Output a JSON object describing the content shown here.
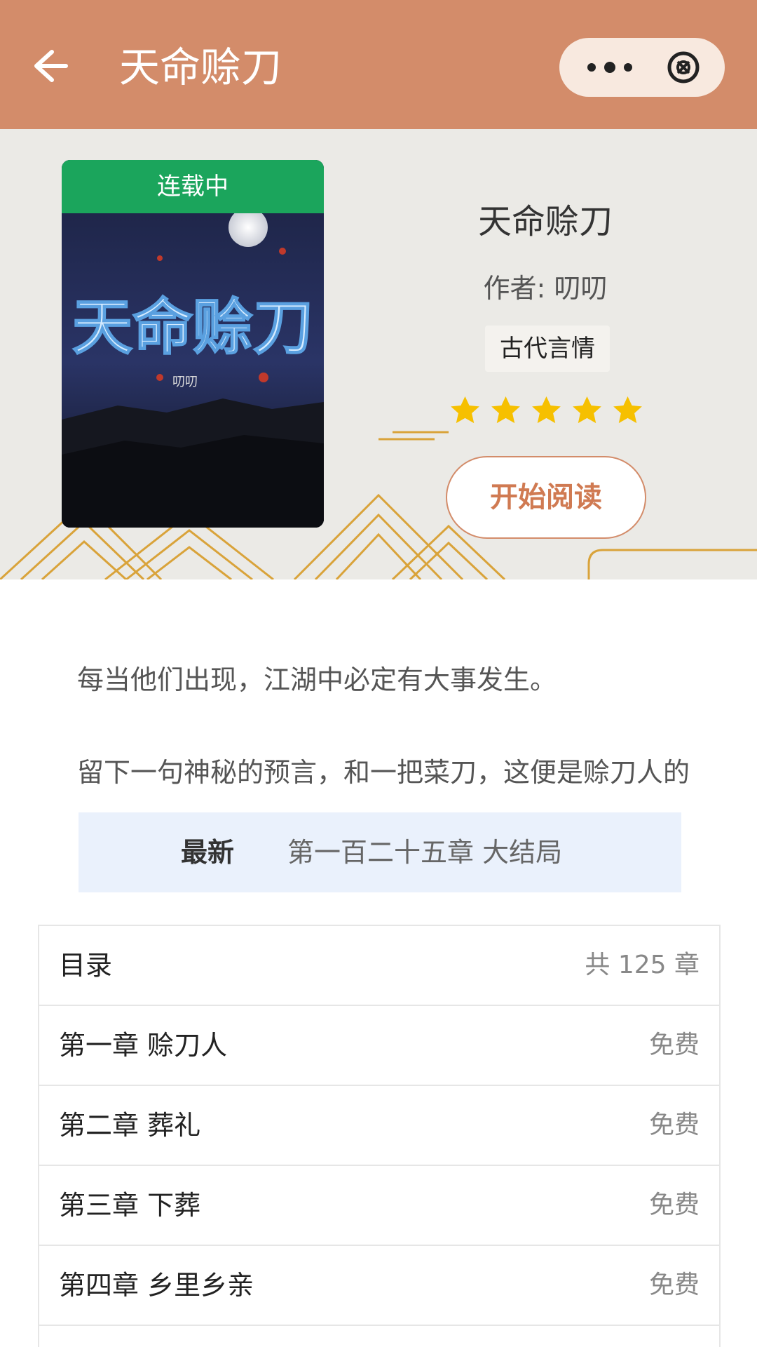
{
  "navbar": {
    "title": "天命赊刀",
    "back_icon": "arrow-left-icon",
    "more_icon": "more-dots-icon",
    "close_icon": "close-circle-icon",
    "color": "#d38c6a"
  },
  "book": {
    "status": "连载中",
    "title": "天命赊刀",
    "author": "作者: 叨叨",
    "genre": "古代言情",
    "rating_stars": 5,
    "read_button": "开始阅读",
    "cover_title": "天命赊刀",
    "cover_author": "叨叨"
  },
  "intro": {
    "line1": "每当他们出现，江湖中必定有大事发生。",
    "line2": "留下一句神秘的预言，和一把菜刀，这便是赊刀人的"
  },
  "latest": {
    "label": "最新",
    "chapter": "第一百二十五章 大结局"
  },
  "toc": {
    "header": "目录",
    "count": "共 125 章",
    "chapters": [
      {
        "title": "第一章 赊刀人",
        "price": "免费"
      },
      {
        "title": "第二章 葬礼",
        "price": "免费"
      },
      {
        "title": "第三章 下葬",
        "price": "免费"
      },
      {
        "title": "第四章 乡里乡亲",
        "price": "免费"
      }
    ]
  },
  "colors": {
    "accent": "#d38c6a",
    "status_green": "#1ba55c",
    "star": "#f6c000",
    "latest_bg": "#eaf1fc"
  }
}
